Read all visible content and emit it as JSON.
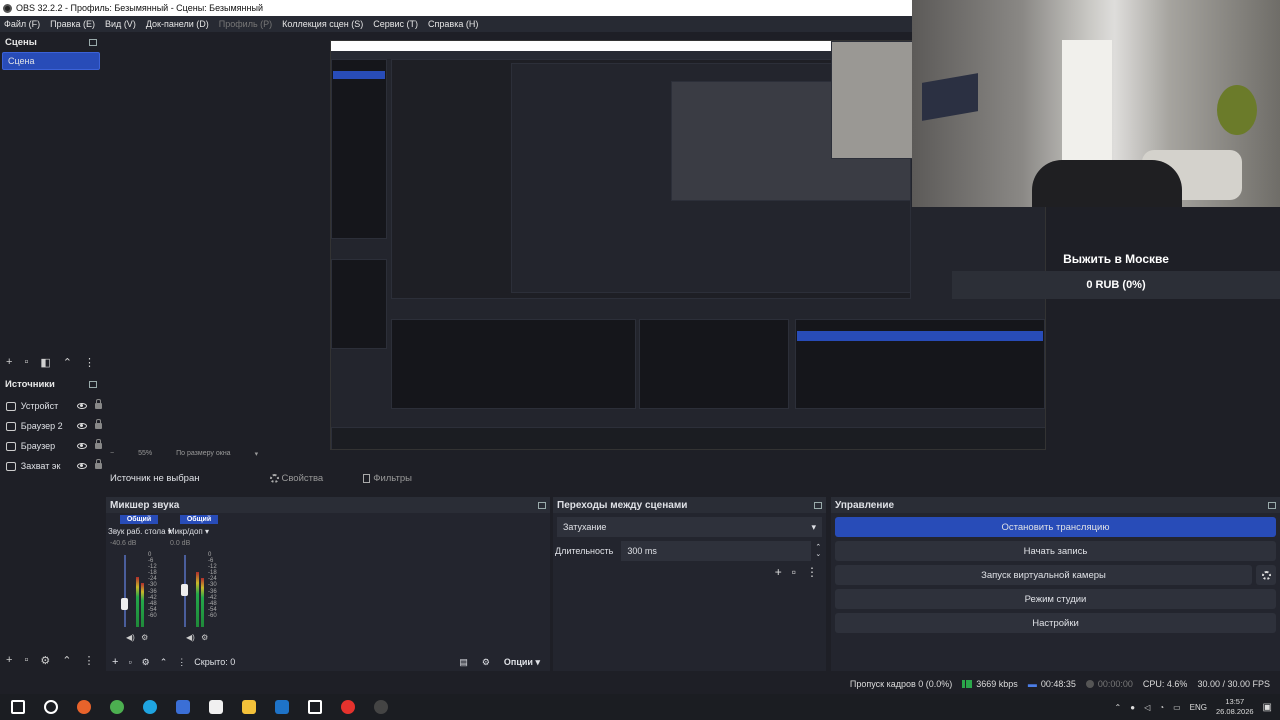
{
  "window": {
    "title": "OBS 32.2.2 - Профиль: Безымянный - Сцены: Безымянный"
  },
  "menu": [
    {
      "label": "Файл (F)",
      "disabled": false
    },
    {
      "label": "Правка (E)",
      "disabled": false
    },
    {
      "label": "Вид (V)",
      "disabled": false
    },
    {
      "label": "Док-панели (D)",
      "disabled": false
    },
    {
      "label": "Профиль (P)",
      "disabled": true
    },
    {
      "label": "Коллекция сцен (S)",
      "disabled": false
    },
    {
      "label": "Сервис (T)",
      "disabled": false
    },
    {
      "label": "Справка (H)",
      "disabled": false
    }
  ],
  "scenes": {
    "title": "Сцены",
    "items": [
      "Сцена"
    ]
  },
  "sources": {
    "title": "Источники",
    "items": [
      "Устройст",
      "Браузер 2",
      "Браузер",
      "Захват эк"
    ]
  },
  "preview": {
    "zoom": "55%",
    "fit": "По размеру окна"
  },
  "overlay": {
    "title": "Выжить в Москве",
    "value": "0 RUB (0%)"
  },
  "properties_bar": {
    "no_source": "Источник не выбран",
    "properties": "Свойства",
    "filters": "Фильтры"
  },
  "mixer": {
    "title": "Микшер звука",
    "channels": [
      {
        "tag": "Общий",
        "name": "Звук раб. стола",
        "db": "-40.6 dB",
        "level": 0.4
      },
      {
        "tag": "Общий",
        "name": "Микр/доп",
        "db": "0.0 dB",
        "level": 0.6
      }
    ],
    "scale": [
      "0",
      "-6",
      "-12",
      "-18",
      "-24",
      "-30",
      "-36",
      "-42",
      "-48",
      "-54",
      "-60"
    ],
    "hidden": "Скрыто: 0",
    "options": "Опции"
  },
  "transitions": {
    "title": "Переходы между сценами",
    "selected": "Затухание",
    "duration_label": "Длительность",
    "duration_value": "300 ms"
  },
  "controls": {
    "title": "Управление",
    "stop_stream": "Остановить трансляцию",
    "start_record": "Начать запись",
    "virtual_cam": "Запуск виртуальной камеры",
    "studio_mode": "Режим студии",
    "settings": "Настройки"
  },
  "status": {
    "dropped": "Пропуск кадров 0 (0.0%)",
    "bitrate": "3669 kbps",
    "stream_time": "00:48:35",
    "record_time": "00:00:00",
    "cpu": "CPU: 4.6%",
    "fps": "30.00 / 30.00 FPS"
  },
  "taskbar": {
    "apps": [
      {
        "icon": "start-icon",
        "color": "#ffffff"
      },
      {
        "icon": "search-icon",
        "color": "#ffffff"
      },
      {
        "icon": "firefox-icon",
        "color": "#e8632b"
      },
      {
        "icon": "chrome-icon",
        "color": "#4caf50"
      },
      {
        "icon": "edge-icon",
        "color": "#1fa4e0"
      },
      {
        "icon": "save-icon",
        "color": "#3b6fd6"
      },
      {
        "icon": "store-icon",
        "color": "#f0f0f0"
      },
      {
        "icon": "folder-icon",
        "color": "#f3c13a"
      },
      {
        "icon": "outlook-icon",
        "color": "#1e73c8"
      },
      {
        "icon": "sparkle-icon",
        "color": "#ffffff"
      },
      {
        "icon": "yandex-icon",
        "color": "#e5322d"
      },
      {
        "icon": "obs-icon",
        "color": "#444444"
      }
    ],
    "lang": "ENG",
    "time": "13:57",
    "date": "26.08.2026"
  }
}
